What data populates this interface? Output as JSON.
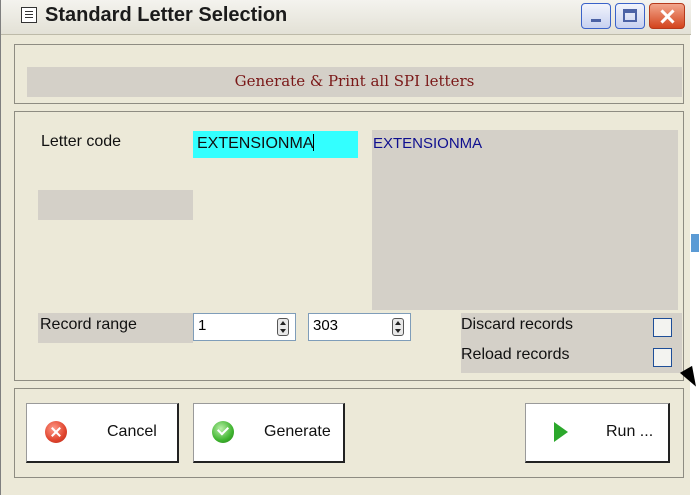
{
  "window": {
    "title": "Standard Letter Selection",
    "icon": "window-app-icon",
    "controls": [
      "minimize-icon",
      "maximize-icon",
      "close-icon"
    ]
  },
  "header": {
    "text": "Generate & Print all SPI letters",
    "color": "#7a1818"
  },
  "letter": {
    "label": "Letter code",
    "value": "EXTENSIONMA",
    "field_bg": "#33ffff",
    "description": "EXTENSIONMA",
    "description_color": "#0f0f8f"
  },
  "range": {
    "label": "Record range",
    "from": "1",
    "to": "303"
  },
  "options": {
    "discard_label": "Discard records",
    "discard_checked": false,
    "reload_label": "Reload records",
    "reload_checked": false
  },
  "buttons": {
    "cancel": "Cancel",
    "generate": "Generate",
    "run": "Run ..."
  }
}
